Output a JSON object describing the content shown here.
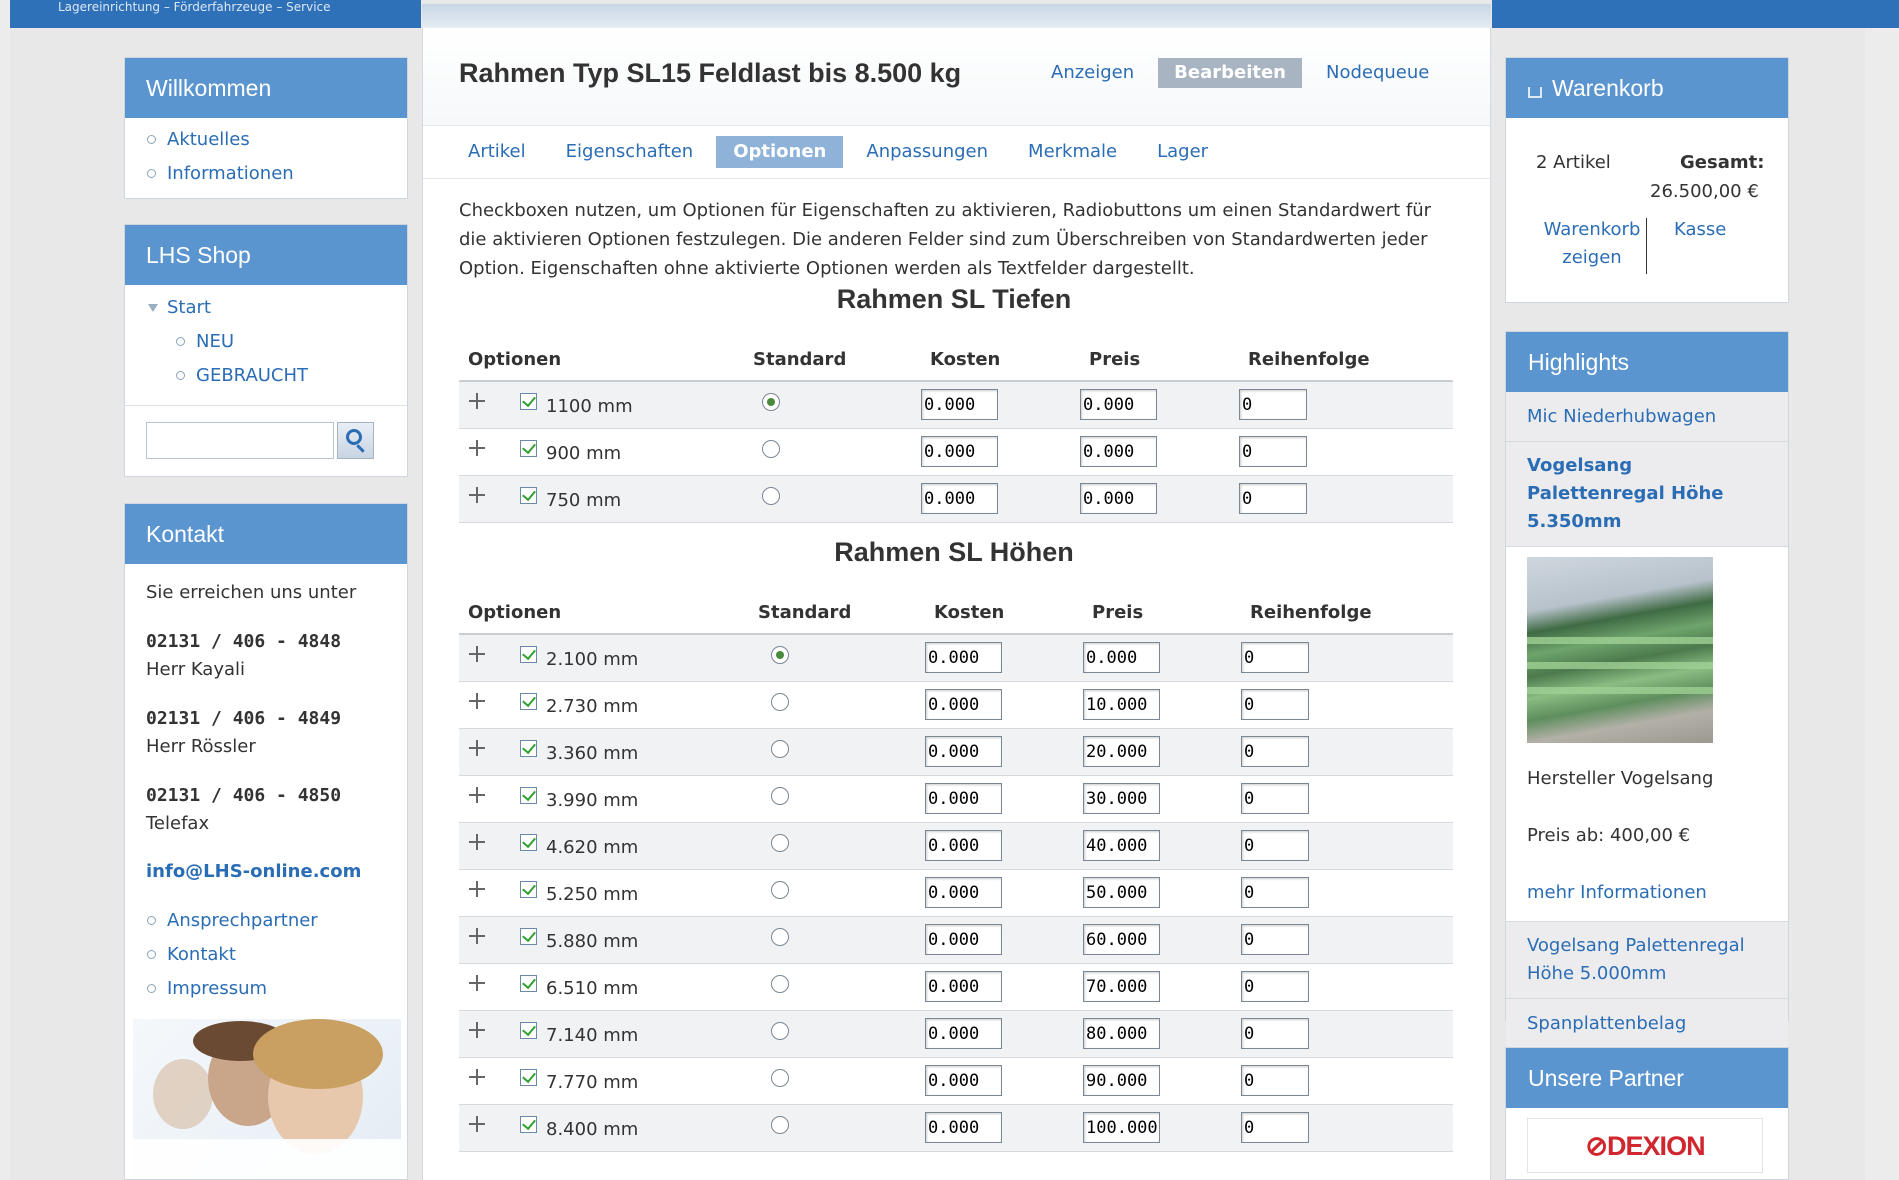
{
  "header": {
    "slogan": "Lagereinrichtung – Förderfahrzeuge – Service"
  },
  "sidebar_left": {
    "welcome": {
      "title": "Willkommen",
      "items": [
        "Aktuelles",
        "Informationen"
      ]
    },
    "shop": {
      "title": "LHS Shop",
      "start": "Start",
      "subitems": [
        "NEU",
        "GEBRAUCHT"
      ],
      "search_placeholder": ""
    },
    "contact": {
      "title": "Kontakt",
      "intro": "Sie erreichen uns unter",
      "entries": [
        {
          "phone": "02131 / 406 - 4848",
          "name": "Herr Kayali"
        },
        {
          "phone": "02131 / 406 - 4849",
          "name": "Herr Rössler"
        },
        {
          "phone": "02131 / 406 - 4850",
          "name": "Telefax"
        }
      ],
      "email": "info@LHS-online.com",
      "links": [
        "Ansprechpartner",
        "Kontakt",
        "Impressum"
      ]
    }
  },
  "main": {
    "title": "Rahmen Typ SL15 Feldlast bis 8.500 kg",
    "view_tabs": [
      {
        "label": "Anzeigen",
        "active": false
      },
      {
        "label": "Bearbeiten",
        "active": true
      },
      {
        "label": "Nodequeue",
        "active": false
      }
    ],
    "sub_tabs": [
      {
        "label": "Artikel",
        "active": false
      },
      {
        "label": "Eigenschaften",
        "active": false
      },
      {
        "label": "Optionen",
        "active": true
      },
      {
        "label": "Anpassungen",
        "active": false
      },
      {
        "label": "Merkmale",
        "active": false
      },
      {
        "label": "Lager",
        "active": false
      }
    ],
    "description": "Checkboxen nutzen, um Optionen für Eigenschaften zu aktivieren, Radiobuttons um einen Standardwert für die aktivieren Optionen festzulegen. Die anderen Felder sind zum Überschreiben von Standardwerten jeder Option. Eigenschaften ohne aktivierte Optionen werden als Textfelder dargestellt.",
    "columns": [
      "Optionen",
      "Standard",
      "Kosten",
      "Preis",
      "Reihenfolge"
    ],
    "sections": [
      {
        "title": "Rahmen SL Tiefen",
        "rows": [
          {
            "label": "1100 mm",
            "checked": true,
            "default": true,
            "kosten": "0.000",
            "preis": "0.000",
            "reihenfolge": "0"
          },
          {
            "label": "900 mm",
            "checked": true,
            "default": false,
            "kosten": "0.000",
            "preis": "0.000",
            "reihenfolge": "0"
          },
          {
            "label": "750 mm",
            "checked": true,
            "default": false,
            "kosten": "0.000",
            "preis": "0.000",
            "reihenfolge": "0"
          }
        ]
      },
      {
        "title": "Rahmen SL Höhen",
        "rows": [
          {
            "label": "2.100 mm",
            "checked": true,
            "default": true,
            "kosten": "0.000",
            "preis": "0.000",
            "reihenfolge": "0"
          },
          {
            "label": "2.730 mm",
            "checked": true,
            "default": false,
            "kosten": "0.000",
            "preis": "10.000",
            "reihenfolge": "0"
          },
          {
            "label": "3.360 mm",
            "checked": true,
            "default": false,
            "kosten": "0.000",
            "preis": "20.000",
            "reihenfolge": "0"
          },
          {
            "label": "3.990 mm",
            "checked": true,
            "default": false,
            "kosten": "0.000",
            "preis": "30.000",
            "reihenfolge": "0"
          },
          {
            "label": "4.620 mm",
            "checked": true,
            "default": false,
            "kosten": "0.000",
            "preis": "40.000",
            "reihenfolge": "0"
          },
          {
            "label": "5.250 mm",
            "checked": true,
            "default": false,
            "kosten": "0.000",
            "preis": "50.000",
            "reihenfolge": "0"
          },
          {
            "label": "5.880 mm",
            "checked": true,
            "default": false,
            "kosten": "0.000",
            "preis": "60.000",
            "reihenfolge": "0"
          },
          {
            "label": "6.510 mm",
            "checked": true,
            "default": false,
            "kosten": "0.000",
            "preis": "70.000",
            "reihenfolge": "0"
          },
          {
            "label": "7.140 mm",
            "checked": true,
            "default": false,
            "kosten": "0.000",
            "preis": "80.000",
            "reihenfolge": "0"
          },
          {
            "label": "7.770 mm",
            "checked": true,
            "default": false,
            "kosten": "0.000",
            "preis": "90.000",
            "reihenfolge": "0"
          },
          {
            "label": "8.400 mm",
            "checked": true,
            "default": false,
            "kosten": "0.000",
            "preis": "100.000",
            "reihenfolge": "0"
          }
        ]
      }
    ]
  },
  "sidebar_right": {
    "cart": {
      "title": "Warenkorb",
      "count": "2 Artikel",
      "total_label": "Gesamt:",
      "total_value": "26.500,00 €",
      "show_cart": "Warenkorb zeigen",
      "checkout": "Kasse"
    },
    "highlights": {
      "title": "Highlights",
      "item1": "Mic Niederhubwagen",
      "item2": "Vogelsang Palettenregal Höhe 5.350mm",
      "manufacturer": "Hersteller Vogelsang",
      "price": "Preis ab: 400,00 €",
      "more": "mehr Informationen",
      "item3": "Vogelsang Palettenregal Höhe 5.000mm",
      "item4": "Spanplattenbelag"
    },
    "partners": {
      "title": "Unsere Partner",
      "logo_text": "⊘DEXION"
    }
  },
  "colors": {
    "brand_blue": "#5b95d0",
    "link_blue": "#2a6db5",
    "top_bar": "#2f71b8",
    "active_tab": "#8fb3d8",
    "active_view_tab": "#a8b4c2"
  }
}
